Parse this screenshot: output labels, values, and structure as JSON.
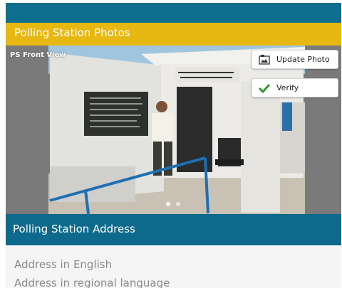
{
  "photos_section": {
    "title": "Polling Station Photos",
    "caption": "PS Front View",
    "update_button": {
      "label": "Update Photo",
      "icon": "photo-icon"
    },
    "verify_button": {
      "label": "Verify",
      "icon": "checkmark-icon",
      "icon_color": "#2e9a2e"
    },
    "carousel": {
      "total": 2,
      "active": 1
    }
  },
  "address_section": {
    "title": "Polling Station Address",
    "fields": [
      "Address in English",
      "Address in regional language"
    ]
  },
  "colors": {
    "primary": "#0d6a8c",
    "accent": "#e7b812"
  }
}
